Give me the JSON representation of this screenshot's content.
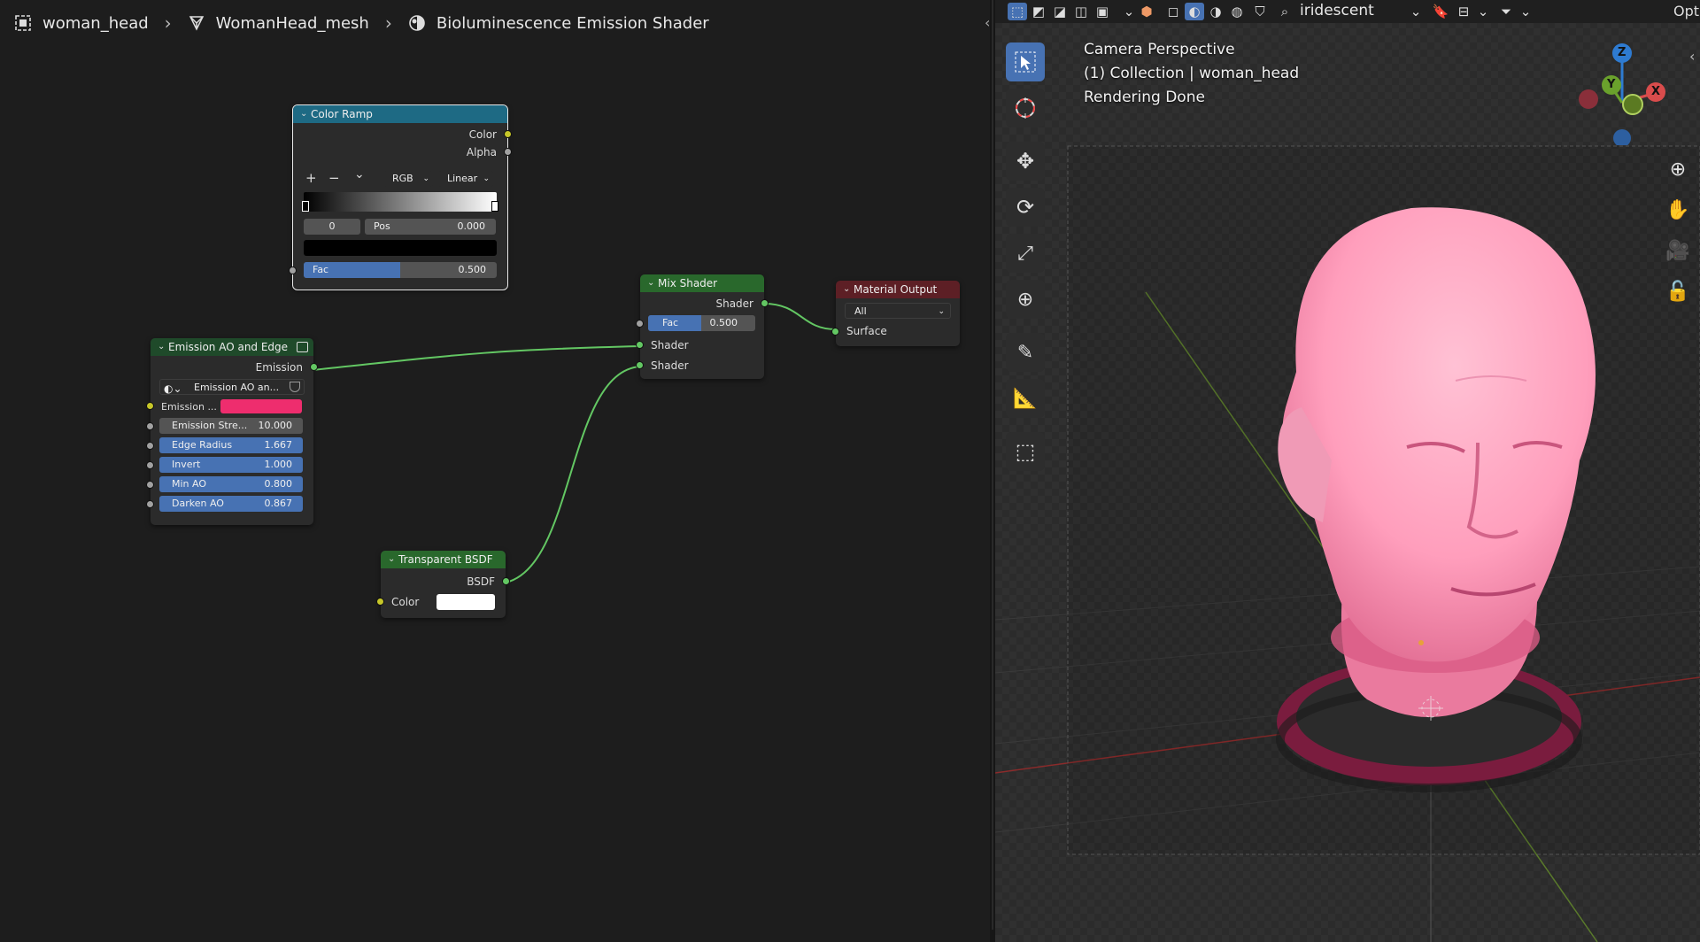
{
  "breadcrumb": {
    "object": "woman_head",
    "mesh": "WomanHead_mesh",
    "material": "Bioluminescence Emission Shader"
  },
  "nodes": {
    "color_ramp": {
      "title": "Color Ramp",
      "out_color": "Color",
      "out_alpha": "Alpha",
      "add": "+",
      "remove": "−",
      "more": "⌄",
      "mode": "RGB",
      "interpolation": "Linear",
      "index": "0",
      "pos_label": "Pos",
      "pos_value": "0.000",
      "fac_label": "Fac",
      "fac_value": "0.500",
      "fac_level": 0.5
    },
    "emission_group": {
      "title": "Emission AO and Edge",
      "out_emission": "Emission",
      "datablock": "Emission AO an...",
      "emission_color_label": "Emission ...",
      "emission_color": "#ee2d6e",
      "params": [
        {
          "label": "Emission Stre...",
          "value": "10.000"
        },
        {
          "label": "Edge Radius",
          "value": "1.667"
        },
        {
          "label": "Invert",
          "value": "1.000"
        },
        {
          "label": "Min AO",
          "value": "0.800"
        },
        {
          "label": "Darken AO",
          "value": "0.867"
        }
      ]
    },
    "mix_shader": {
      "title": "Mix Shader",
      "out_shader": "Shader",
      "fac_label": "Fac",
      "fac_value": "0.500",
      "in_shader_1": "Shader",
      "in_shader_2": "Shader"
    },
    "material_output": {
      "title": "Material Output",
      "target": "All",
      "in_surface": "Surface"
    },
    "transparent_bsdf": {
      "title": "Transparent BSDF",
      "out_bsdf": "BSDF",
      "color_label": "Color",
      "color": "#ffffff"
    }
  },
  "viewport": {
    "search_text": "iridescent",
    "options_label": "Opti",
    "overlay": {
      "line1": "Camera Perspective",
      "line2": "(1) Collection | woman_head",
      "line3": "Rendering Done"
    },
    "gizmo": {
      "x": "X",
      "y": "Y",
      "z": "Z"
    }
  },
  "colors": {
    "accent_blue": "#4772b3",
    "header_colorramp": "#1e6a84",
    "header_group": "#1f4a2a",
    "header_shader": "#29682c",
    "header_output": "#5d1f25",
    "emission_pink": "#ee2d6e",
    "link_green": "#63c763"
  }
}
